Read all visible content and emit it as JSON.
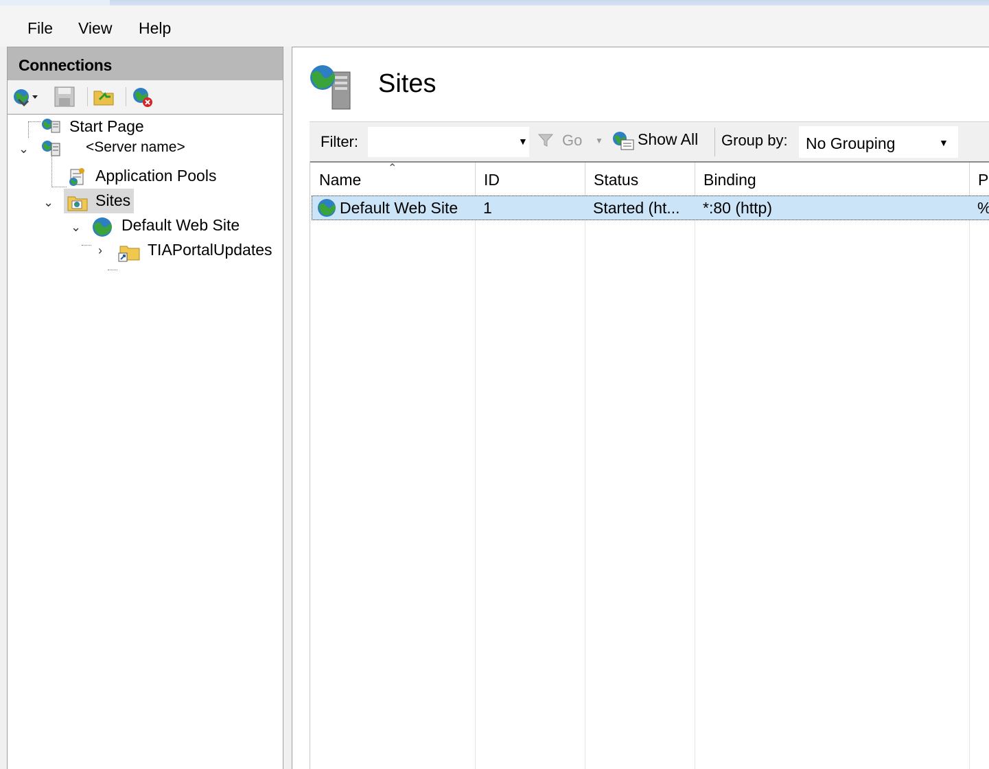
{
  "menu": {
    "items": [
      "File",
      "View",
      "Help"
    ]
  },
  "connections": {
    "title": "Connections",
    "toolbar_icons": [
      "globe-connect-icon",
      "save-icon",
      "folder-up-icon",
      "disconnect-icon"
    ],
    "tree": {
      "start_page": "Start Page",
      "server": "<Server name>",
      "app_pools": "Application Pools",
      "sites": "Sites",
      "default_web_site": "Default Web Site",
      "tia_portal_updates": "TIAPortalUpdates"
    }
  },
  "main": {
    "title": "Sites",
    "filter": {
      "label": "Filter:",
      "value": "",
      "go": "Go",
      "show_all": "Show All",
      "group_by_label": "Group by:",
      "group_by_value": "No Grouping"
    },
    "table": {
      "columns": [
        "Name",
        "ID",
        "Status",
        "Binding",
        "Pa"
      ],
      "rows": [
        {
          "name": "Default Web Site",
          "id": "1",
          "status": "Started (ht...",
          "binding": "*:80 (http)",
          "path": "%"
        }
      ]
    }
  },
  "colors": {
    "selection": "#cce4f7",
    "pane_header": "#b8b8b8"
  }
}
